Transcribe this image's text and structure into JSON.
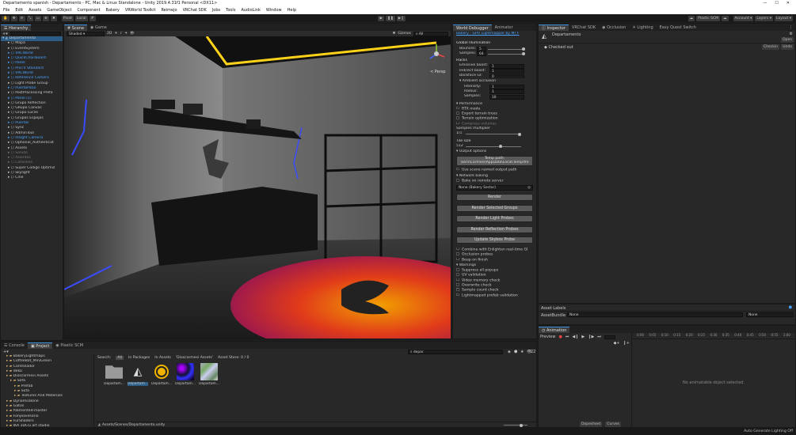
{
  "titlebar": {
    "title": "Departamento spanish - Departamento - PC, Mac & Linux Standalone - Unity 2019.4.31f1 Personal <DX11>",
    "minimize": "—",
    "maximize": "☐",
    "close": "✕"
  },
  "menubar": [
    "File",
    "Edit",
    "Assets",
    "GameObject",
    "Component",
    "Bakery",
    "VRWorld Toolkit",
    "Reimejo",
    "VRChat SDK",
    "Jobs",
    "Tools",
    "AudioLink",
    "Window",
    "Help"
  ],
  "toolbar": {
    "pivot": "Pivot",
    "local": "Local",
    "plastic": "Plastic SCM",
    "account": "Account",
    "layers": "Layers",
    "layout": "Layout"
  },
  "hierarchy": {
    "tab": "Hierarchy",
    "items": [
      {
        "label": "Departamento",
        "indent": 0,
        "sel": true,
        "blue": false
      },
      {
        "label": "Mapa",
        "indent": 1,
        "blue": false
      },
      {
        "label": "EventSystem",
        "indent": 1,
        "blue": false
      },
      {
        "label": "VRCWorld",
        "indent": 1,
        "blue": true
      },
      {
        "label": "QuickChairBoard",
        "indent": 1,
        "blue": true
      },
      {
        "label": "Panel",
        "indent": 1,
        "blue": true
      },
      {
        "label": "ProTV Standard",
        "indent": 1,
        "blue": true
      },
      {
        "label": "VRCWorld",
        "indent": 1,
        "blue": true
      },
      {
        "label": "Reference Camera",
        "indent": 1,
        "blue": true
      },
      {
        "label": "Light Probe Group",
        "indent": 1,
        "blue": false
      },
      {
        "label": "PuertaPatio",
        "indent": 1,
        "blue": true
      },
      {
        "label": "PostProcessing Prefa",
        "indent": 1,
        "blue": false
      },
      {
        "label": "Panel (1)",
        "indent": 1,
        "blue": true
      },
      {
        "label": "Grupo Reflection",
        "indent": 1,
        "blue": false
      },
      {
        "label": "GRupo Canvas",
        "indent": 1,
        "blue": false
      },
      {
        "label": "Grupo Luces",
        "indent": 1,
        "blue": false
      },
      {
        "label": "Grupos Espejos",
        "indent": 1,
        "blue": false
      },
      {
        "label": "Puertas",
        "indent": 1,
        "blue": true
      },
      {
        "label": "Sync",
        "indent": 1,
        "blue": false
      },
      {
        "label": "AdminTool",
        "indent": 1,
        "blue": false
      },
      {
        "label": "Insight Camera",
        "indent": 1,
        "blue": true
      },
      {
        "label": "Optional_Authenticat",
        "indent": 1,
        "blue": false
      },
      {
        "label": "Assets",
        "indent": 1,
        "blue": false
      },
      {
        "label": "Sonido",
        "indent": 1,
        "dim": true
      },
      {
        "label": "Asientos",
        "indent": 1,
        "dim": true
      },
      {
        "label": "Collisions",
        "indent": 1,
        "dim": true
      },
      {
        "label": "Super Codigo Optimiz",
        "indent": 1,
        "blue": false
      },
      {
        "label": "Skylight",
        "indent": 1,
        "blue": false
      },
      {
        "label": "Cine",
        "indent": 1,
        "blue": false
      }
    ]
  },
  "scene": {
    "tab_scene": "Scene",
    "tab_game": "Game",
    "shading": "Shaded",
    "mode_2d": "2D",
    "gizmos": "Gizmos",
    "search_placeholder": "All",
    "persp": "< Persp"
  },
  "bakery": {
    "tab1": "World Debugger",
    "tab2": "Animator",
    "header": "Bakery - GPU Lightmapper by Mr F",
    "global_illum": "Global Illumination",
    "bounces_label": "Bounces:",
    "bounces": "5",
    "samples_label": "Samples:",
    "samples": "64",
    "hacks": "Hacks",
    "emissive_label": "Emissive boost:",
    "emissive": "1",
    "indirect_label": "Indirect boost:",
    "indirect": "1",
    "backface_label": "Backface GI:",
    "backface": "0",
    "ao": "Ambient occlusion",
    "intensity_label": "Intensity:",
    "intensity": "1",
    "radius_label": "Radius:",
    "radius": "1",
    "ao_samples_label": "Samples:",
    "ao_samples": "16",
    "performance": "Performance",
    "rtx": "RTX mode",
    "export_trees": "Export terrain trees",
    "terrain_opt": "Terrain optimization",
    "compress": "Compress volumes",
    "samples_mult_label": "Samples multiplier",
    "samples_mult": "1/1",
    "tile_label": "Tile size",
    "tile": "512",
    "output": "Output options",
    "temp_label": "Temp path:",
    "temp_path": "\\sers\\Carmesi\\AppData\\Local\\Temp\\fre",
    "use_scene": "Use scene named output path",
    "network": "Network baking",
    "remote": "Bake on remote server",
    "sector": "None (Bakery Sector)",
    "btn_render": "Render",
    "btn_groups": "Render Selected Groups",
    "btn_probes": "Render Light Probes",
    "btn_reflection": "Render Reflection Probes",
    "btn_skybox": "Update Skybox Probe",
    "combine": "Combine with Enlighten real-time GI",
    "occlusion": "Occlusion probes",
    "beep": "Beep on finish",
    "warnings": "Warnings",
    "suppress": "Suppress all popups",
    "uv": "UV validation",
    "vmem": "Video memory check",
    "overwrite": "Overwrite check",
    "sample_count": "Sample count check",
    "lightmapped": "Lightmapped prefab validation"
  },
  "inspector": {
    "tab1": "Inspector",
    "tab2": "VRChat SDK",
    "tab3": "Occlusion",
    "tab4": "Lighting",
    "tab5": "Easy Quest Switch",
    "object": "Departamento",
    "open": "Open",
    "checked_out": "Checked out",
    "checkin": "Checkin",
    "undo": "Undo"
  },
  "assetlabels": {
    "title": "Asset Labels",
    "bundle_label": "AssetBundle",
    "bundle": "None",
    "variant": "None"
  },
  "animation": {
    "tab": "Animation",
    "preview": "Preview",
    "empty": "No animatable object selected.",
    "dopesheet": "Dopesheet",
    "curves": "Curves",
    "timecodes": [
      "0:00",
      "0:05",
      "0:10",
      "0:15",
      "0:20",
      "0:25",
      "0:30",
      "0:35",
      "0:40",
      "0:45",
      "0:50",
      "0:55",
      "1:00"
    ]
  },
  "project": {
    "tab1": "Console",
    "tab2": "Project",
    "tab3": "Plastic SCM",
    "search": "depar",
    "count": "22",
    "search_label": "Search:",
    "filter_all": "All",
    "filter_packages": "In Packages",
    "filter_assets": "In Assets",
    "filter_folder": "'Dioscarmesi Assets'",
    "filter_store": "Asset Store: 0 / 0",
    "tree": [
      {
        "label": "BakeryLightmaps",
        "indent": 1
      },
      {
        "label": "CoffeeBot_MiniGreen",
        "indent": 1
      },
      {
        "label": "Controlador",
        "indent": 1
      },
      {
        "label": "deko",
        "indent": 1
      },
      {
        "label": "Dioscarmesi Assets",
        "indent": 1
      },
      {
        "label": "Sofa",
        "indent": 2
      },
      {
        "label": "Prefab",
        "indent": 3
      },
      {
        "label": "Sofa",
        "indent": 3
      },
      {
        "label": "Textures And Materials",
        "indent": 3
      },
      {
        "label": "DynamicBone",
        "indent": 1
      },
      {
        "label": "Gatos",
        "indent": 1
      },
      {
        "label": "filamented-master",
        "indent": 1
      },
      {
        "label": "Fonjeavesario",
        "indent": 1
      },
      {
        "label": "FurShaders",
        "indent": 1
      },
      {
        "label": "IKA 3DCG art studio",
        "indent": 1
      }
    ],
    "assets": [
      {
        "label": "Departam...",
        "kind": "folder"
      },
      {
        "label": "Departam...",
        "kind": "unity"
      },
      {
        "label": "Departam...",
        "kind": "bakery"
      },
      {
        "label": "Departam...",
        "kind": "tex1"
      },
      {
        "label": "Departam...",
        "kind": "tex2"
      }
    ],
    "path": "Assets/Scenes/Departamento.unity"
  },
  "statusbar": {
    "text": "Auto Generate Lighting Off"
  }
}
